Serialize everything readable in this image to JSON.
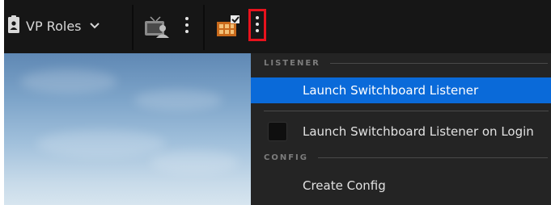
{
  "toolbar": {
    "vp_roles_label": "VP Roles",
    "icons": [
      "vp-roles-icon",
      "chevron-down-icon",
      "virtual-camera-icon",
      "kebab-icon",
      "switchboard-icon",
      "kebab-icon"
    ],
    "highlight_color": "#e8121d"
  },
  "menu": {
    "sections": [
      {
        "label": "LISTENER",
        "items": [
          {
            "label": "Launch Switchboard Listener",
            "highlighted": true
          },
          {
            "label": "Launch Switchboard Listener on Login",
            "checkbox": true,
            "checked": false
          }
        ]
      },
      {
        "label": "CONFIG",
        "items": [
          {
            "label": "Create Config"
          }
        ]
      }
    ],
    "accent_color": "#0a6ad9"
  }
}
